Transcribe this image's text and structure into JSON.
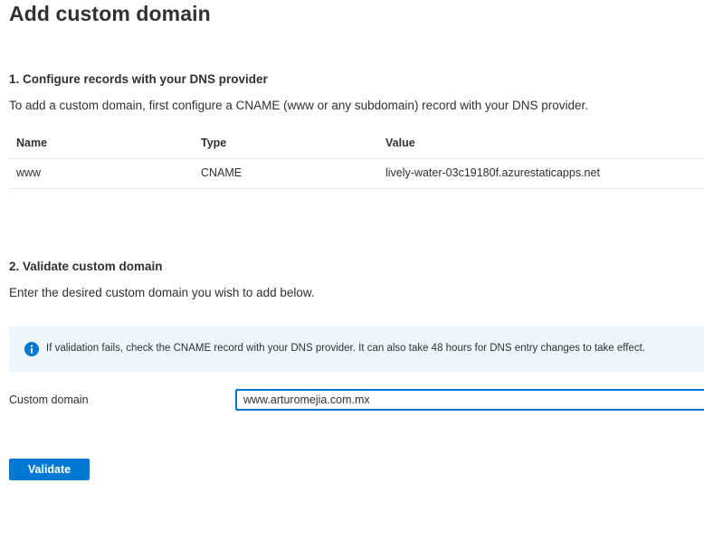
{
  "page": {
    "title": "Add custom domain"
  },
  "step1": {
    "heading": "1. Configure records with your DNS provider",
    "description": "To add a custom domain, first configure a CNAME (www or any subdomain) record with your DNS provider.",
    "table": {
      "columns": [
        "Name",
        "Type",
        "Value"
      ],
      "rows": [
        {
          "name": "www",
          "type": "CNAME",
          "value": "lively-water-03c19180f.azurestaticapps.net"
        }
      ]
    }
  },
  "step2": {
    "heading": "2. Validate custom domain",
    "description": "Enter the desired custom domain you wish to add below.",
    "info": {
      "icon": "info-icon",
      "text": "If validation fails, check the CNAME record with your DNS provider. It can also take 48 hours for DNS entry changes to take effect."
    },
    "field": {
      "label": "Custom domain",
      "value": "www.arturomejia.com.mx"
    },
    "validate_label": "Validate"
  },
  "colors": {
    "accent": "#0078d4",
    "info_bg": "#eff6fc",
    "text": "#323130",
    "divider": "#edebe9"
  }
}
